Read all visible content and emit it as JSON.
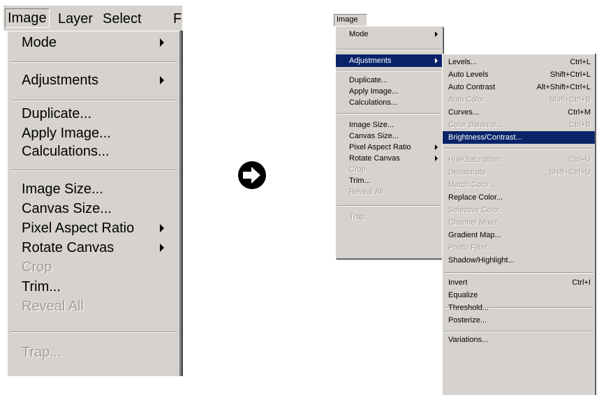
{
  "left": {
    "menubar": [
      "Image",
      "Layer",
      "Select",
      "F"
    ],
    "items": {
      "mode": "Mode",
      "adjustments": "Adjustments",
      "duplicate": "Duplicate...",
      "apply_image": "Apply Image...",
      "calculations": "Calculations...",
      "image_size": "Image Size...",
      "canvas_size": "Canvas Size...",
      "pixel_aspect_ratio": "Pixel Aspect Ratio",
      "rotate_canvas": "Rotate Canvas",
      "crop": "Crop",
      "trim": "Trim...",
      "reveal_all": "Reveal All",
      "trap": "Trap..."
    }
  },
  "right": {
    "menubar": "Image",
    "items": {
      "mode": "Mode",
      "adjustments": "Adjustments",
      "duplicate": "Duplicate...",
      "apply_image": "Apply Image...",
      "calculations": "Calculations...",
      "image_size": "Image Size...",
      "canvas_size": "Canvas Size...",
      "pixel_aspect_ratio": "Pixel Aspect Ratio",
      "rotate_canvas": "Rotate Canvas",
      "crop": "Crop",
      "trim": "Trim...",
      "reveal_all": "Reveal All",
      "trap": "Trap..."
    },
    "submenu": {
      "levels": {
        "label": "Levels...",
        "shortcut": "Ctrl+L"
      },
      "auto_levels": {
        "label": "Auto Levels",
        "shortcut": "Shift+Ctrl+L"
      },
      "auto_contrast": {
        "label": "Auto Contrast",
        "shortcut": "Alt+Shift+Ctrl+L"
      },
      "auto_color": {
        "label": "Auto Color",
        "shortcut": "Shift+Ctrl+B"
      },
      "curves": {
        "label": "Curves...",
        "shortcut": "Ctrl+M"
      },
      "color_balance": {
        "label": "Color Balance...",
        "shortcut": "Ctrl+B"
      },
      "brightness_contrast": {
        "label": "Brightness/Contrast..."
      },
      "hue_saturation": {
        "label": "Hue/Saturation...",
        "shortcut": "Ctrl+U"
      },
      "desaturate": {
        "label": "Desaturate",
        "shortcut": "Shift+Ctrl+U"
      },
      "match_color": {
        "label": "Match Color..."
      },
      "replace_color": {
        "label": "Replace Color..."
      },
      "selective_color": {
        "label": "Selective Color..."
      },
      "channel_mixer": {
        "label": "Channel Mixer..."
      },
      "gradient_map": {
        "label": "Gradient Map..."
      },
      "photo_filter": {
        "label": "Photo Filter..."
      },
      "shadow_highlight": {
        "label": "Shadow/Highlight..."
      },
      "invert": {
        "label": "Invert",
        "shortcut": "Ctrl+I"
      },
      "equalize": {
        "label": "Equalize"
      },
      "threshold": {
        "label": "Threshold..."
      },
      "posterize": {
        "label": "Posterize..."
      },
      "variations": {
        "label": "Variations..."
      }
    }
  },
  "colors": {
    "menu_bg": "#d6d3ce",
    "highlight_bg": "#0a246a",
    "disabled_text": "#a09d98"
  },
  "icons": {
    "transition": "arrow-right-circle-icon"
  }
}
